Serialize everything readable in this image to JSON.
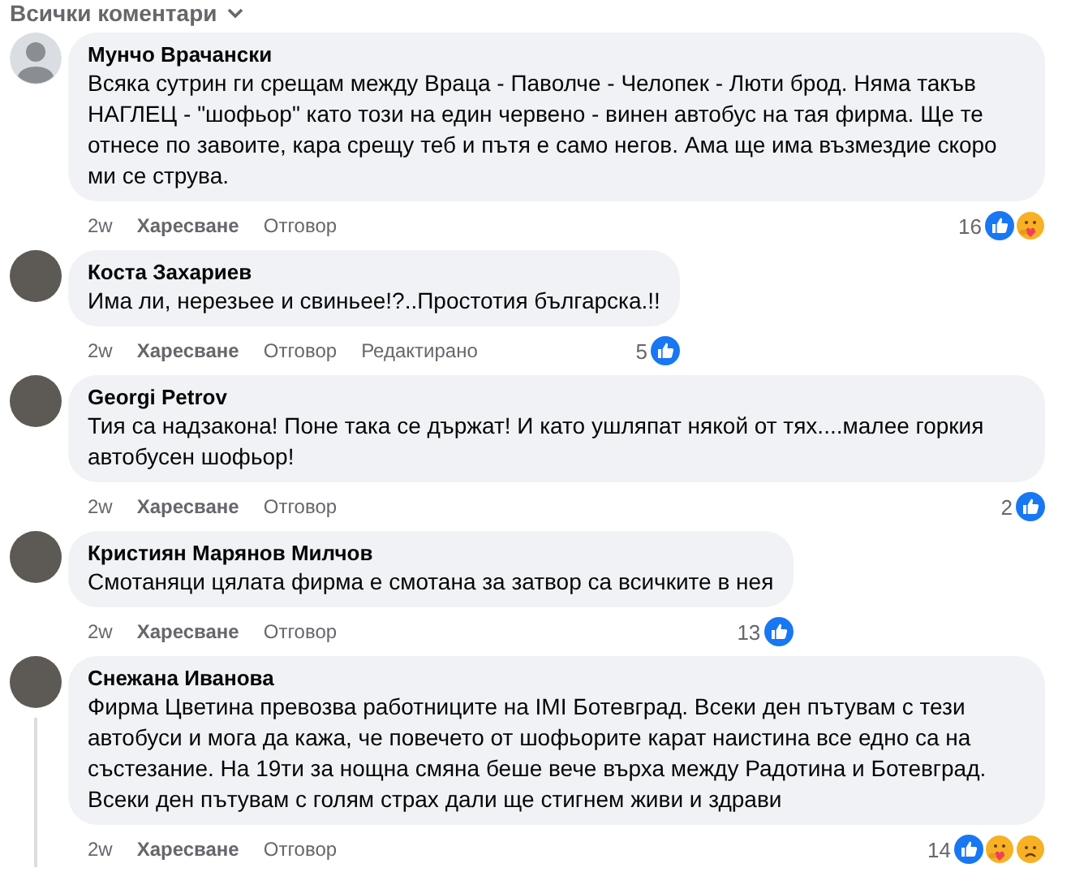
{
  "header": {
    "label": "Всички коментари"
  },
  "comments": [
    {
      "avatar": {
        "kind": "silhouette"
      },
      "author": "Мунчо Врачански",
      "text": "Всяка сутрин ги срещам между Враца - Паволче - Челопек - Люти брод. Няма такъв НАГЛЕЦ - \"шофьор\" като този на един червено - винен автобус на тая фирма. Ще те отнесе по завоите, кара срещу теб и пътя е само негов. Ама ще има възмездие скоро ми се струва.",
      "time": "2w",
      "like": "Харесване",
      "reply": "Отговор",
      "count": "16",
      "reactions": [
        {
          "kind": "like"
        },
        {
          "kind": "care"
        }
      ],
      "thread": false
    },
    {
      "avatar": {
        "kind": "photo"
      },
      "author": "Коста Захариев",
      "text": "Има ли, нерезьее и свиньее!?..Простотия българска.!!",
      "time": "2w",
      "like": "Харесване",
      "reply": "Отговор",
      "edited": "Редактирано",
      "count": "5",
      "reactions": [
        {
          "kind": "like"
        }
      ],
      "thread": false
    },
    {
      "avatar": {
        "kind": "photo"
      },
      "author": "Georgi Petrov",
      "text": "Тия са надзакона! Поне така се държат! И като ушляпат някой от тях....малее горкия автобусен шофьор!",
      "time": "2w",
      "like": "Харесване",
      "reply": "Отговор",
      "count": "2",
      "reactions": [
        {
          "kind": "like"
        }
      ],
      "thread": false
    },
    {
      "avatar": {
        "kind": "photo"
      },
      "author": "Кристиян Марянов Милчов",
      "text": "Смотаняци цялата фирма е смотана за затвор са всичките в нея",
      "time": "2w",
      "like": "Харесване",
      "reply": "Отговор",
      "count": "13",
      "reactions": [
        {
          "kind": "like"
        }
      ],
      "thread": false
    },
    {
      "avatar": {
        "kind": "photo"
      },
      "author": "Снежана Иванова",
      "text": "Фирма Цветина превозва работниците на IMI Ботевград. Всеки ден пътувам с тези автобуси и мога да кажа, че повечето от шофьорите карат наистина все едно са на състезание. На 19ти за нощна смяна беше вече върха между Радотина и Ботевград. Всеки ден пътувам с голям страх дали ще стигнем живи и здрави",
      "time": "2w",
      "like": "Харесване",
      "reply": "Отговор",
      "count": "14",
      "reactions": [
        {
          "kind": "like"
        },
        {
          "kind": "care"
        },
        {
          "kind": "sad"
        }
      ],
      "thread": true
    }
  ]
}
